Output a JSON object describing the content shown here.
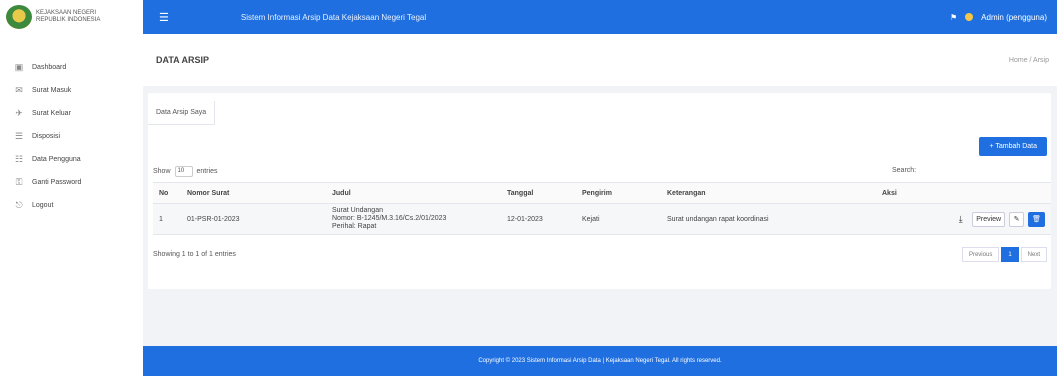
{
  "brand": {
    "line1": "KEJAKSAAN NEGERI",
    "line2": "REPUBLIK INDONESIA"
  },
  "header": {
    "title": "Sistem Informasi Arsip Data Kejaksaan Negeri Tegal",
    "user": "Admin (pengguna)"
  },
  "sidebar": {
    "items": [
      {
        "label": "Dashboard",
        "icon": "dashboard-icon",
        "glyph": "▣"
      },
      {
        "label": "Surat Masuk",
        "icon": "inbox-icon",
        "glyph": "✉"
      },
      {
        "label": "Surat Keluar",
        "icon": "outbox-icon",
        "glyph": "✈"
      },
      {
        "label": "Disposisi",
        "icon": "document-icon",
        "glyph": "☰"
      },
      {
        "label": "Data Pengguna",
        "icon": "users-icon",
        "glyph": "☷"
      },
      {
        "label": "Ganti Password",
        "icon": "key-icon",
        "glyph": "⚿"
      },
      {
        "label": "Logout",
        "icon": "logout-icon",
        "glyph": "⎋"
      }
    ]
  },
  "page": {
    "title": "DATA ARSIP",
    "crumb": "Home / Arsip"
  },
  "card": {
    "tab": "Data Arsip Saya",
    "add_button": "+ Tambah Data",
    "show_label": "Show",
    "show_value": "10",
    "entries_label": "entries",
    "search_label": "Search:"
  },
  "table": {
    "headers": [
      "No",
      "Nomor Surat",
      "Judul",
      "Tanggal",
      "Pengirim",
      "Keterangan",
      "Aksi"
    ],
    "rows": [
      {
        "no": "1",
        "nomor": "01-PSR-01-2023",
        "judul": [
          "Surat Undangan",
          "Nomor: B-1245/M.3.16/Cs.2/01/2023",
          "Perihal: Rapat"
        ],
        "tanggal": "12-01-2023",
        "pengirim": "Kejati",
        "keterangan": "Surat undangan rapat koordinasi",
        "actions": {
          "download": "⤓",
          "preview": "Preview",
          "edit": "✎",
          "delete": "🗑"
        }
      }
    ]
  },
  "info": "Showing 1 to 1 of 1 entries",
  "pager": {
    "prev": "Previous",
    "current": "1",
    "next": "Next"
  },
  "footer": "Copyright © 2023 Sistem Informasi Arsip Data | Kejaksaan Negeri Tegal. All rights reserved."
}
